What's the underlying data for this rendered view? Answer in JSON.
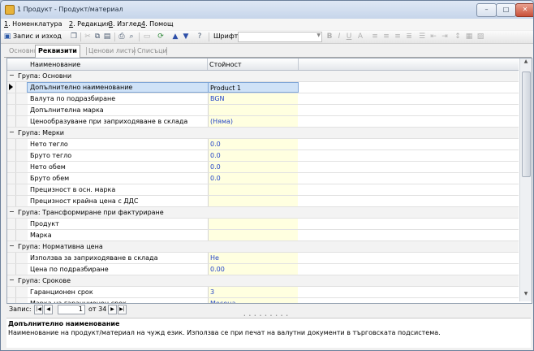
{
  "window": {
    "title": "1 Продукт - Продукт/материал",
    "buttons": {
      "minimize": "–",
      "maximize": "□",
      "close": "✕"
    }
  },
  "menu": [
    {
      "key": "1",
      "label": ". Номенклатура"
    },
    {
      "key": "2",
      "label": ". Редакция"
    },
    {
      "key": "3",
      "label": ". Изглед"
    },
    {
      "key": "4",
      "label": ". Помощ"
    }
  ],
  "toolbar": {
    "save_exit_label": "Запис и изход",
    "font_label": "Шрифт:",
    "font_value": ""
  },
  "tabs": [
    {
      "label": "Основни",
      "active": false
    },
    {
      "label": "Реквизити",
      "active": true
    },
    {
      "label": "Ценови листи",
      "active": false
    },
    {
      "label": "Списъци",
      "active": false
    }
  ],
  "grid": {
    "headers": {
      "name": "Наименование",
      "value": "Стойност"
    },
    "rows": [
      {
        "type": "group",
        "label": "Група: Основни"
      },
      {
        "type": "prop",
        "name": "Допълнително наименование",
        "value": "Product 1",
        "selected": true
      },
      {
        "type": "prop",
        "name": "Валута по подразбиране",
        "value": "BGN"
      },
      {
        "type": "prop",
        "name": "Допълнителна марка",
        "value": ""
      },
      {
        "type": "prop",
        "name": "Ценообразуване при заприходяване в склада",
        "value": "(Няма)"
      },
      {
        "type": "group",
        "label": "Група: Мерки"
      },
      {
        "type": "prop",
        "name": "Нето тегло",
        "value": "0.0"
      },
      {
        "type": "prop",
        "name": "Бруто тегло",
        "value": "0.0"
      },
      {
        "type": "prop",
        "name": "Нето обем",
        "value": "0.0"
      },
      {
        "type": "prop",
        "name": "Бруто обем",
        "value": "0.0"
      },
      {
        "type": "prop",
        "name": "Прецизност в осн. марка",
        "value": ""
      },
      {
        "type": "prop",
        "name": "Прецизност крайна цена с ДДС",
        "value": ""
      },
      {
        "type": "group",
        "label": "Група: Трансформиране при фактуриране"
      },
      {
        "type": "prop",
        "name": "Продукт",
        "value": ""
      },
      {
        "type": "prop",
        "name": "Марка",
        "value": ""
      },
      {
        "type": "group",
        "label": "Група: Нормативна цена"
      },
      {
        "type": "prop",
        "name": "Използва за заприходяване в склада",
        "value": "Не"
      },
      {
        "type": "prop",
        "name": "Цена по подразбиране",
        "value": "0.00"
      },
      {
        "type": "group",
        "label": "Група: Срокове"
      },
      {
        "type": "prop",
        "name": "Гаранционен срок",
        "value": "3"
      },
      {
        "type": "prop",
        "name": "Марка на гаранционен срок",
        "value": "Месеца"
      }
    ]
  },
  "navigator": {
    "label": "Запис:",
    "current": "1",
    "of_label": "от 34"
  },
  "description": {
    "title": "Допълнително наименование",
    "text": "Наименование на продукт/материал на чужд език. Използва се при печат на валутни документи в търговската подсистема."
  }
}
